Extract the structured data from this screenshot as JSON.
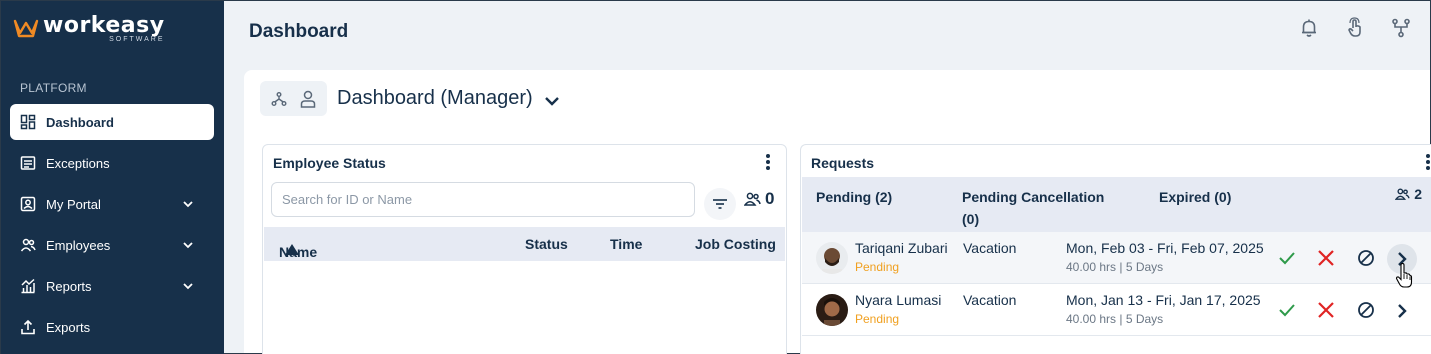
{
  "app": {
    "logo_main": "workeasy",
    "logo_sub": "SOFTWARE",
    "brand_color": "#f08a24"
  },
  "sidebar": {
    "section_label": "PLATFORM",
    "items": [
      {
        "label": "Dashboard",
        "icon": "dashboard-icon",
        "active": true
      },
      {
        "label": "Exceptions",
        "icon": "exceptions-icon"
      },
      {
        "label": "My Portal",
        "icon": "portal-icon",
        "expandable": true
      },
      {
        "label": "Employees",
        "icon": "employees-icon",
        "expandable": true
      },
      {
        "label": "Reports",
        "icon": "reports-icon",
        "expandable": true
      },
      {
        "label": "Exports",
        "icon": "exports-icon"
      }
    ]
  },
  "header": {
    "title": "Dashboard",
    "icons": [
      "bell-icon",
      "touch-icon",
      "org-chart-icon"
    ]
  },
  "main": {
    "dashboard_title": "Dashboard (Manager)"
  },
  "employee_status": {
    "title": "Employee Status",
    "search_placeholder": "Search for ID or Name",
    "count": "0",
    "columns": {
      "name": "Name",
      "status": "Status",
      "time": "Time",
      "job_costing": "Job Costing"
    }
  },
  "requests": {
    "title": "Requests",
    "tabs": {
      "pending": "Pending (2)",
      "pending_cancellation_1": "Pending Cancellation",
      "pending_cancellation_2": "(0)",
      "expired": "Expired (0)"
    },
    "count": "2",
    "rows": [
      {
        "name": "Tariqani Zubari",
        "status": "Pending",
        "type": "Vacation",
        "dates": "Mon, Feb 03 - Fri, Feb 07, 2025",
        "hours": "40.00 hrs | 5 Days"
      },
      {
        "name": "Nyara Lumasi",
        "status": "Pending",
        "type": "Vacation",
        "dates": "Mon, Jan 13 - Fri, Jan 17, 2025",
        "hours": "40.00 hrs | 5 Days"
      }
    ]
  }
}
